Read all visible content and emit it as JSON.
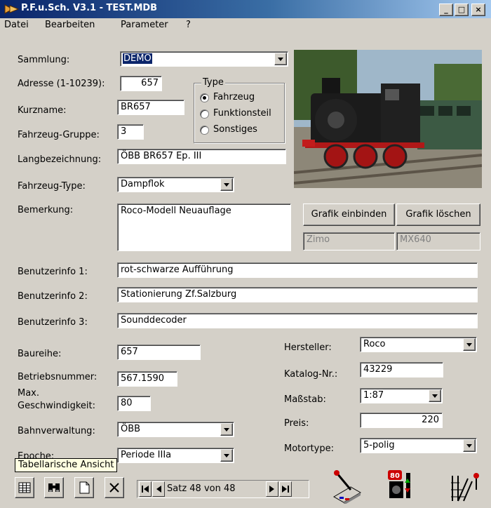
{
  "window": {
    "title": "P.F.u.Sch. V3.1 - TEST.MDB",
    "minimize": "_",
    "maximize": "□",
    "close": "×"
  },
  "menu": {
    "datei": "Datei",
    "bearbeiten": "Bearbeiten",
    "parameter": "Parameter",
    "help": "?"
  },
  "form": {
    "sammlung_label": "Sammlung:",
    "sammlung_value": "DEMO",
    "adresse_label": "Adresse (1-10239):",
    "adresse_value": "657",
    "kurzname_label": "Kurzname:",
    "kurzname_value": "BR657",
    "gruppe_label": "Fahrzeug-Gruppe:",
    "gruppe_value": "3",
    "lang_label": "Langbezeichnung:",
    "lang_value": "ÖBB BR657 Ep. III",
    "type_label": "Fahrzeug-Type:",
    "type_value": "Dampflok",
    "bemerkung_label": "Bemerkung:",
    "bemerkung_value": "Roco-Modell Neuauflage",
    "info1_label": "Benutzerinfo 1:",
    "info1_value": "rot-schwarze Aufführung",
    "info2_label": "Benutzerinfo 2:",
    "info2_value": "Stationierung Zf.Salzburg",
    "info3_label": "Benutzerinfo 3:",
    "info3_value": "Sounddecoder",
    "baureihe_label": "Baureihe:",
    "baureihe_value": "657",
    "betriebsnr_label": "Betriebsnummer:",
    "betriebsnr_value": "567.1590",
    "maxgeschw_label1": "Max.",
    "maxgeschw_label2": "Geschwindigkeit:",
    "maxgeschw_value": "80",
    "bahnverw_label": "Bahnverwaltung:",
    "bahnverw_value": "ÖBB",
    "epoche_label": "Epoche:",
    "epoche_value": "Periode IIIa",
    "hersteller_label": "Hersteller:",
    "hersteller_value": "Roco",
    "katalog_label": "Katalog-Nr.:",
    "katalog_value": "43229",
    "massstab_label": "Maßstab:",
    "massstab_value": "1:87",
    "preis_label": "Preis:",
    "preis_value": "220",
    "motortype_label": "Motortype:",
    "motortype_value": "5-polig"
  },
  "type_group": {
    "title": "Type",
    "options": [
      {
        "label": "Fahrzeug",
        "selected": true
      },
      {
        "label": "Funktionsteil",
        "selected": false
      },
      {
        "label": "Sonstiges",
        "selected": false
      }
    ]
  },
  "grafik": {
    "einbinden_label": "Grafik einbinden",
    "loeschen_label": "Grafik löschen",
    "decoder_maker": "Zimo",
    "decoder_type": "MX640"
  },
  "toolbar": {
    "tooltip": "Tabellarische Ansicht",
    "record_text": "Satz  48 von  48"
  },
  "icons": {
    "table": "table-icon",
    "search": "binoculars-icon",
    "new": "new-document-icon",
    "delete": "delete-icon",
    "control": "throttle-icon",
    "signal": "locomotive-signal-icon",
    "turnout": "turnout-icon"
  },
  "colors": {
    "titlebar": "#0a246a",
    "selection": "#0a246a",
    "window": "#d4d0c8",
    "tooltip": "#ffffe1"
  }
}
